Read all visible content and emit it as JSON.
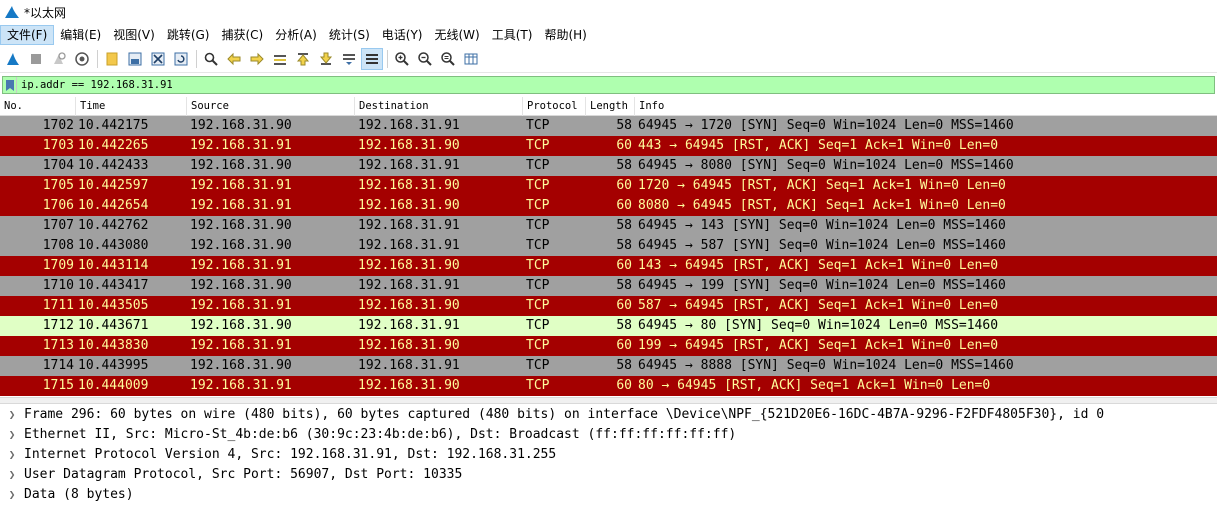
{
  "window": {
    "title": "*以太网"
  },
  "menu": [
    {
      "label": "文件(F)",
      "active": true
    },
    {
      "label": "编辑(E)"
    },
    {
      "label": "视图(V)"
    },
    {
      "label": "跳转(G)"
    },
    {
      "label": "捕获(C)"
    },
    {
      "label": "分析(A)"
    },
    {
      "label": "统计(S)"
    },
    {
      "label": "电话(Y)"
    },
    {
      "label": "无线(W)"
    },
    {
      "label": "工具(T)"
    },
    {
      "label": "帮助(H)"
    }
  ],
  "toolbar": {
    "icons": [
      "shark-fin-start-icon",
      "stop-icon",
      "restart-icon",
      "capture-options-icon",
      "open-folder-icon",
      "save-file-icon",
      "close-file-icon",
      "reload-icon",
      "find-icon",
      "go-back-icon",
      "go-forward-icon",
      "go-to-packet-icon",
      "go-first-icon",
      "go-last-icon",
      "autoscroll-icon",
      "colorize-icon",
      "zoom-in-icon",
      "zoom-out-icon",
      "zoom-normal-icon",
      "resize-columns-icon"
    ]
  },
  "filter": {
    "value": "ip.addr == 192.168.31.91"
  },
  "columns": {
    "no": "No.",
    "time": "Time",
    "source": "Source",
    "destination": "Destination",
    "protocol": "Protocol",
    "length": "Length",
    "info": "Info"
  },
  "colors": {
    "syn_row": "#a0a0a0",
    "rst_row": "#a40000",
    "rst_text": "#fffc9c",
    "selected_row": "#e0ffc5",
    "filter_valid": "#afffaf"
  },
  "packets": [
    {
      "no": "1702",
      "time": "10.442175",
      "src": "192.168.31.90",
      "dst": "192.168.31.91",
      "proto": "TCP",
      "len": "58",
      "info": "64945 → 1720 [SYN] Seq=0 Win=1024 Len=0 MSS=1460",
      "kind": "syn"
    },
    {
      "no": "1703",
      "time": "10.442265",
      "src": "192.168.31.91",
      "dst": "192.168.31.90",
      "proto": "TCP",
      "len": "60",
      "info": "443 → 64945 [RST, ACK] Seq=1 Ack=1 Win=0 Len=0",
      "kind": "rst"
    },
    {
      "no": "1704",
      "time": "10.442433",
      "src": "192.168.31.90",
      "dst": "192.168.31.91",
      "proto": "TCP",
      "len": "58",
      "info": "64945 → 8080 [SYN] Seq=0 Win=1024 Len=0 MSS=1460",
      "kind": "syn"
    },
    {
      "no": "1705",
      "time": "10.442597",
      "src": "192.168.31.91",
      "dst": "192.168.31.90",
      "proto": "TCP",
      "len": "60",
      "info": "1720 → 64945 [RST, ACK] Seq=1 Ack=1 Win=0 Len=0",
      "kind": "rst"
    },
    {
      "no": "1706",
      "time": "10.442654",
      "src": "192.168.31.91",
      "dst": "192.168.31.90",
      "proto": "TCP",
      "len": "60",
      "info": "8080 → 64945 [RST, ACK] Seq=1 Ack=1 Win=0 Len=0",
      "kind": "rst"
    },
    {
      "no": "1707",
      "time": "10.442762",
      "src": "192.168.31.90",
      "dst": "192.168.31.91",
      "proto": "TCP",
      "len": "58",
      "info": "64945 → 143 [SYN] Seq=0 Win=1024 Len=0 MSS=1460",
      "kind": "syn"
    },
    {
      "no": "1708",
      "time": "10.443080",
      "src": "192.168.31.90",
      "dst": "192.168.31.91",
      "proto": "TCP",
      "len": "58",
      "info": "64945 → 587 [SYN] Seq=0 Win=1024 Len=0 MSS=1460",
      "kind": "syn"
    },
    {
      "no": "1709",
      "time": "10.443114",
      "src": "192.168.31.91",
      "dst": "192.168.31.90",
      "proto": "TCP",
      "len": "60",
      "info": "143 → 64945 [RST, ACK] Seq=1 Ack=1 Win=0 Len=0",
      "kind": "rst"
    },
    {
      "no": "1710",
      "time": "10.443417",
      "src": "192.168.31.90",
      "dst": "192.168.31.91",
      "proto": "TCP",
      "len": "58",
      "info": "64945 → 199 [SYN] Seq=0 Win=1024 Len=0 MSS=1460",
      "kind": "syn"
    },
    {
      "no": "1711",
      "time": "10.443505",
      "src": "192.168.31.91",
      "dst": "192.168.31.90",
      "proto": "TCP",
      "len": "60",
      "info": "587 → 64945 [RST, ACK] Seq=1 Ack=1 Win=0 Len=0",
      "kind": "rst"
    },
    {
      "no": "1712",
      "time": "10.443671",
      "src": "192.168.31.90",
      "dst": "192.168.31.91",
      "proto": "TCP",
      "len": "58",
      "info": "64945 → 80 [SYN] Seq=0 Win=1024 Len=0 MSS=1460",
      "kind": "sel"
    },
    {
      "no": "1713",
      "time": "10.443830",
      "src": "192.168.31.91",
      "dst": "192.168.31.90",
      "proto": "TCP",
      "len": "60",
      "info": "199 → 64945 [RST, ACK] Seq=1 Ack=1 Win=0 Len=0",
      "kind": "rst"
    },
    {
      "no": "1714",
      "time": "10.443995",
      "src": "192.168.31.90",
      "dst": "192.168.31.91",
      "proto": "TCP",
      "len": "58",
      "info": "64945 → 8888 [SYN] Seq=0 Win=1024 Len=0 MSS=1460",
      "kind": "syn"
    },
    {
      "no": "1715",
      "time": "10.444009",
      "src": "192.168.31.91",
      "dst": "192.168.31.90",
      "proto": "TCP",
      "len": "60",
      "info": "80 → 64945 [RST, ACK] Seq=1 Ack=1 Win=0 Len=0",
      "kind": "rst"
    }
  ],
  "details": [
    "Frame 296: 60 bytes on wire (480 bits), 60 bytes captured (480 bits) on interface \\Device\\NPF_{521D20E6-16DC-4B7A-9296-F2FDF4805F30}, id 0",
    "Ethernet II, Src: Micro-St_4b:de:b6 (30:9c:23:4b:de:b6), Dst: Broadcast (ff:ff:ff:ff:ff:ff)",
    "Internet Protocol Version 4, Src: 192.168.31.91, Dst: 192.168.31.255",
    "User Datagram Protocol, Src Port: 56907, Dst Port: 10335",
    "Data (8 bytes)"
  ]
}
